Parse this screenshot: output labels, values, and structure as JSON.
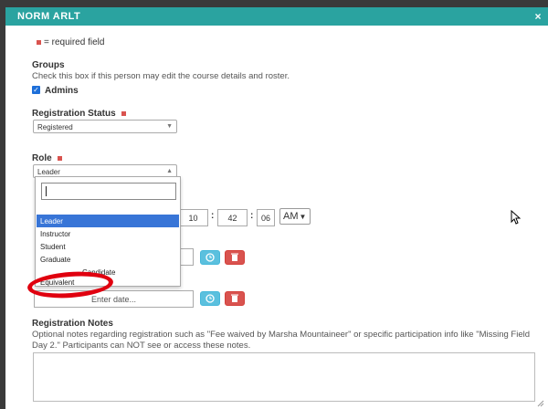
{
  "dialog": {
    "title": "NORM ARLT",
    "close_glyph": "×"
  },
  "legend": {
    "text": "= required field"
  },
  "groups": {
    "label": "Groups",
    "help": "Check this box if this person may edit the course details and roster.",
    "checkbox_label": "Admins",
    "checked": true
  },
  "registration_status": {
    "label": "Registration Status",
    "value": "Registered"
  },
  "role": {
    "label": "Role",
    "value": "Leader",
    "search_value": "",
    "options": [
      "Leader",
      "Instructor",
      "Student",
      "Graduate",
      "Candidate",
      "Equivalent"
    ],
    "selected_index": 0
  },
  "time": {
    "hour": "10",
    "minute": "42",
    "second": "06",
    "ampm": "AM"
  },
  "date_row_2": {
    "placeholder": "Enter date..."
  },
  "notes": {
    "label": "Registration Notes",
    "help": "Optional notes regarding registration such as \"Fee waived by Marsha Mountaineer\" or specific participation info like \"Missing Field Day 2.\" Participants can NOT see or access these notes.",
    "value": ""
  },
  "colors": {
    "titlebar": "#2aa3a0",
    "required": "#d9534f",
    "selected_option": "#3875d7",
    "clock_button": "#5bc0de",
    "delete_button": "#d9534f",
    "annotation": "#e0000f"
  },
  "icons": {
    "close": "close-icon",
    "checkbox": "checkmark-icon",
    "clock": "clock-icon",
    "delete": "trash-icon",
    "caret": "chevron-down-icon"
  }
}
